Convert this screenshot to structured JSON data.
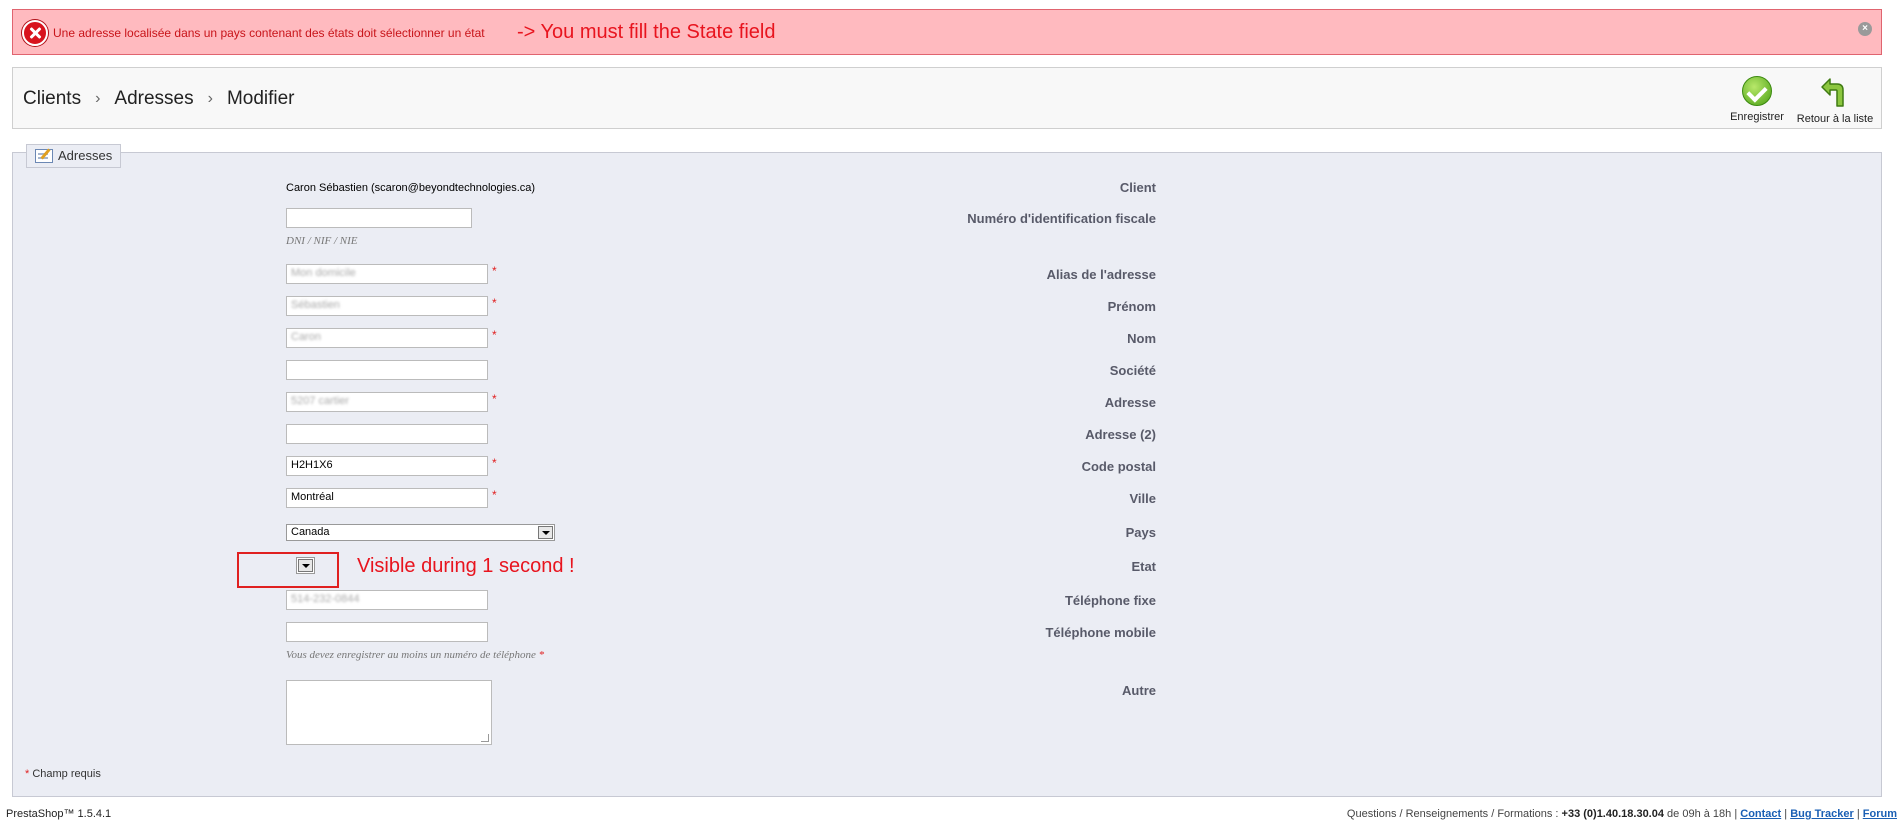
{
  "error": {
    "message": "Une adresse localisée dans un pays contenant des états doit sélectionner un état",
    "annotation": "-> You must fill the State field",
    "close_label": "×"
  },
  "breadcrumb": {
    "items": [
      "Clients",
      "Adresses",
      "Modifier"
    ],
    "separator": "›"
  },
  "toolbar": {
    "save_label": "Enregistrer",
    "back_label": "Retour à la liste"
  },
  "panel": {
    "legend": "Adresses"
  },
  "form": {
    "client_label": "Client",
    "client_value": "Caron Sébastien (scaron@beyondtechnologies.ca)",
    "tax_label": "Numéro d'identification fiscale",
    "tax_value": "",
    "tax_hint": "DNI / NIF / NIE",
    "alias_label": "Alias de l'adresse",
    "alias_value": "Mon domicile",
    "firstname_label": "Prénom",
    "firstname_value": "Sébastien",
    "lastname_label": "Nom",
    "lastname_value": "Caron",
    "company_label": "Société",
    "company_value": "",
    "address_label": "Adresse",
    "address_value": "5207 cartier",
    "address2_label": "Adresse (2)",
    "address2_value": "",
    "postcode_label": "Code postal",
    "postcode_value": "H2H1X6",
    "city_label": "Ville",
    "city_value": "Montréal",
    "country_label": "Pays",
    "country_value": "Canada",
    "state_label": "Etat",
    "state_annotation": "Visible during 1 second !",
    "phone_label": "Téléphone fixe",
    "phone_value": "514-232-0844",
    "mobile_label": "Téléphone mobile",
    "mobile_value": "",
    "phone_hint": "Vous devez enregistrer au moins un numéro de téléphone",
    "other_label": "Autre",
    "required_star": "*",
    "required_note": "Champ requis"
  },
  "footer": {
    "version": "PrestaShop™ 1.5.4.1",
    "info_text": "Questions / Renseignements / Formations : ",
    "phone": "+33 (0)1.40.18.30.04",
    "hours": " de 09h à 18h | ",
    "contact": "Contact",
    "bugtracker": "Bug Tracker",
    "forum": "Forum",
    "sep": " | "
  },
  "colors": {
    "error_bg": "#ffbabf",
    "error_text": "#c8141a",
    "annotation": "#e8141e",
    "panel_bg": "#ebedf4"
  }
}
